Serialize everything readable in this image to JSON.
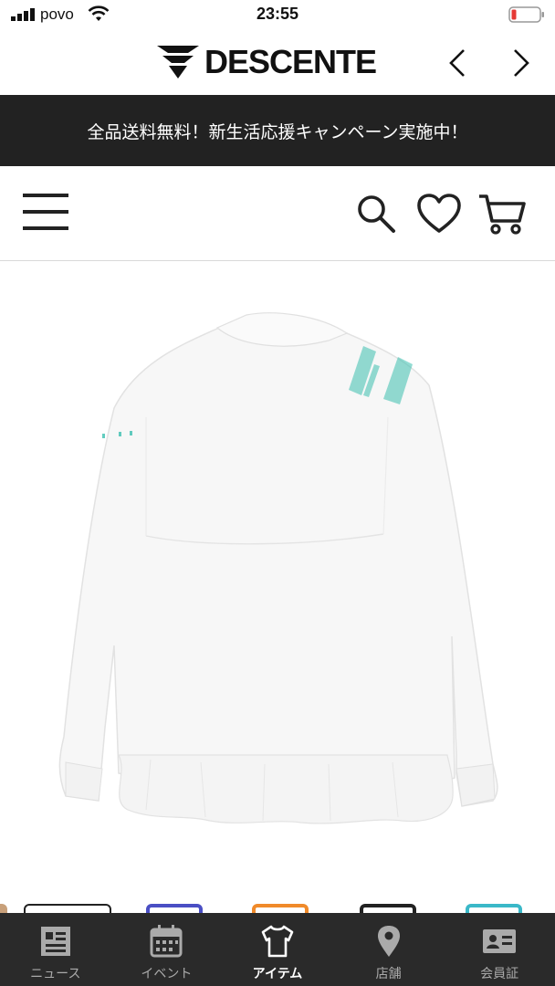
{
  "status_bar": {
    "carrier": "povo",
    "time": "23:55"
  },
  "header": {
    "brand": "DESCENTE"
  },
  "promo": {
    "text": "全品送料無料！新生活応援キャンペーン実施中！"
  },
  "product": {
    "image": "white-jacket-back-icon"
  },
  "thumbnails": {
    "colors": [
      "#c8a07a",
      "#ffffff",
      "#4a4fc4",
      "#f08a2a",
      "#222222",
      "#3ab8c8"
    ]
  },
  "tabbar": {
    "tabs": [
      {
        "label": "ニュース",
        "icon": "news-icon",
        "active": false
      },
      {
        "label": "イベント",
        "icon": "calendar-icon",
        "active": false
      },
      {
        "label": "アイテム",
        "icon": "tshirt-icon",
        "active": true
      },
      {
        "label": "店舗",
        "icon": "location-pin-icon",
        "active": false
      },
      {
        "label": "会員証",
        "icon": "member-card-icon",
        "active": false
      }
    ]
  },
  "colors": {
    "banner_bg": "#222222",
    "tabbar_bg": "#2a2a2a",
    "accent": "#3cc0b0"
  }
}
